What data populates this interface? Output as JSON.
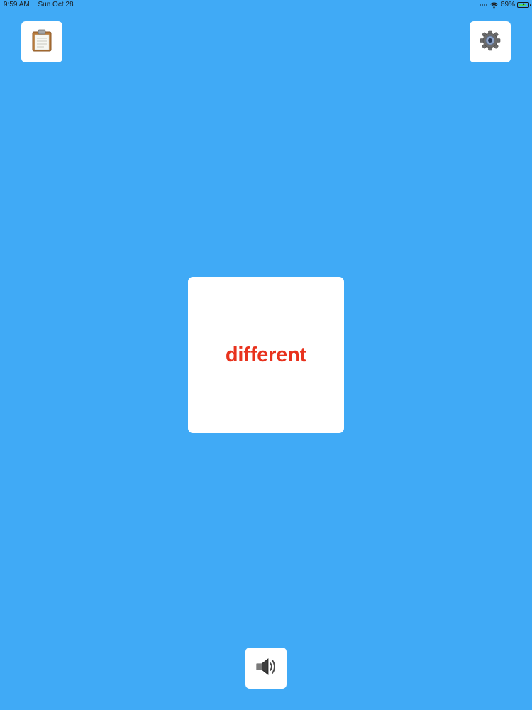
{
  "status_bar": {
    "time": "9:59 AM",
    "date": "Sun Oct 28",
    "battery_percent_label": "69%",
    "battery_level": 0.69,
    "charging": true
  },
  "toolbar": {
    "notes_icon": "clipboard-icon",
    "settings_icon": "gear-icon",
    "sound_icon": "speaker-icon"
  },
  "card": {
    "word": "different",
    "word_color": "#e8321d"
  },
  "colors": {
    "background": "#40aaf6",
    "button_background": "#ffffff",
    "battery_fill": "#4cd964"
  }
}
